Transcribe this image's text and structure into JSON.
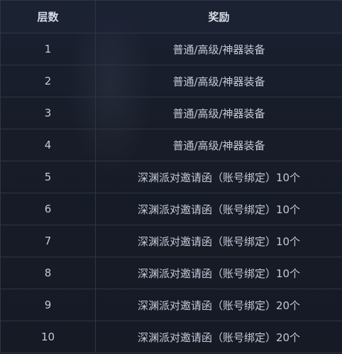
{
  "table": {
    "headers": [
      "层数",
      "奖励"
    ],
    "rows": [
      {
        "level": "1",
        "reward": "普通/高级/神器装备"
      },
      {
        "level": "2",
        "reward": "普通/高级/神器装备"
      },
      {
        "level": "3",
        "reward": "普通/高级/神器装备"
      },
      {
        "level": "4",
        "reward": "普通/高级/神器装备"
      },
      {
        "level": "5",
        "reward": "深渊派对邀请函（账号绑定）10个"
      },
      {
        "level": "6",
        "reward": "深渊派对邀请函（账号绑定）10个"
      },
      {
        "level": "7",
        "reward": "深渊派对邀请函（账号绑定）10个"
      },
      {
        "level": "8",
        "reward": "深渊派对邀请函（账号绑定）10个"
      },
      {
        "level": "9",
        "reward": "深渊派对邀请函（账号绑定）20个"
      },
      {
        "level": "10",
        "reward": "深渊派对邀请函（账号绑定）20个"
      }
    ]
  }
}
